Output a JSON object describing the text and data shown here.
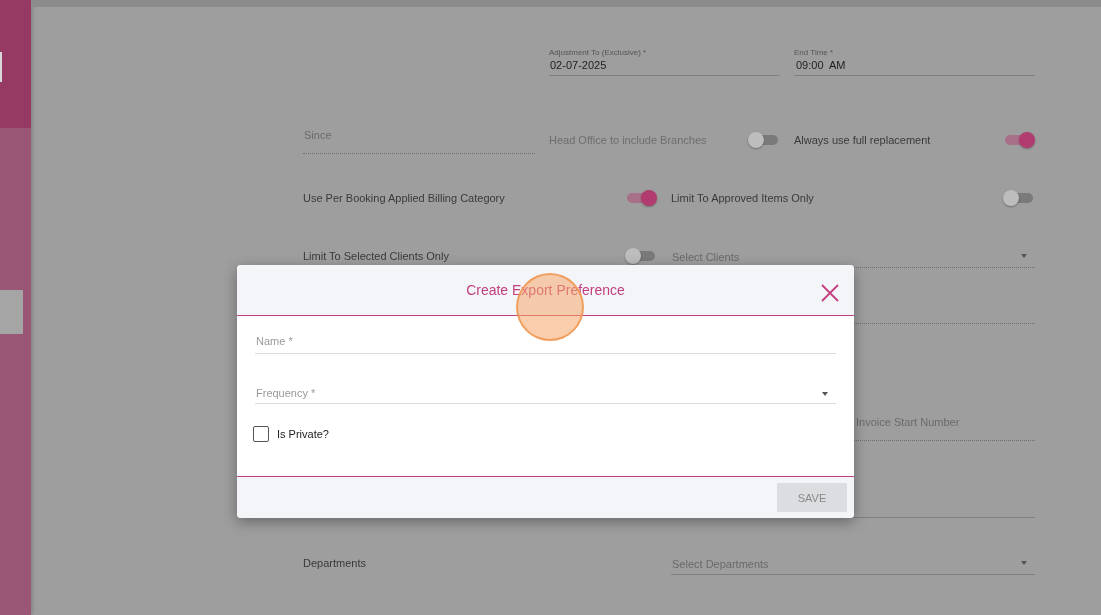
{
  "form": {
    "adjustment_to": {
      "label": "Adjustment To (Exclusive) *",
      "value": "02-07-2025"
    },
    "end_time": {
      "label": "End Time *",
      "value": "09:00  AM"
    },
    "since": {
      "placeholder": "Since",
      "disabled": true
    },
    "head_office": {
      "label": "Head Office to include Branches",
      "on": false,
      "disabled": true
    },
    "always_full": {
      "label": "Always use full replacement",
      "on": true,
      "disabled": false
    },
    "per_booking": {
      "label": "Use Per Booking Applied Billing Category",
      "on": true,
      "disabled": false
    },
    "approved_only": {
      "label": "Limit To Approved Items Only",
      "on": false,
      "disabled": false
    },
    "selected_clients": {
      "label": "Limit To Selected Clients Only",
      "on": false,
      "disabled": false
    },
    "clients_select": {
      "placeholder": "Select Clients",
      "disabled": true
    },
    "hidden_select_1": {
      "disabled": true
    },
    "invoice_start": {
      "placeholder": "Invoice Start Number",
      "disabled": true
    },
    "hidden_select_2": {
      "disabled": false
    },
    "departments": {
      "label": "Departments"
    },
    "departments_select": {
      "placeholder": "Select Departments",
      "disabled": false
    }
  },
  "modal": {
    "title": "Create Export Preference",
    "fields": [
      {
        "kind": "text",
        "placeholder": "Name *"
      },
      {
        "kind": "select",
        "placeholder": "Frequency *"
      }
    ],
    "checkbox": {
      "label": "Is Private?",
      "checked": false
    },
    "buttons": [
      {
        "label": "SAVE",
        "disabled": true
      }
    ]
  }
}
